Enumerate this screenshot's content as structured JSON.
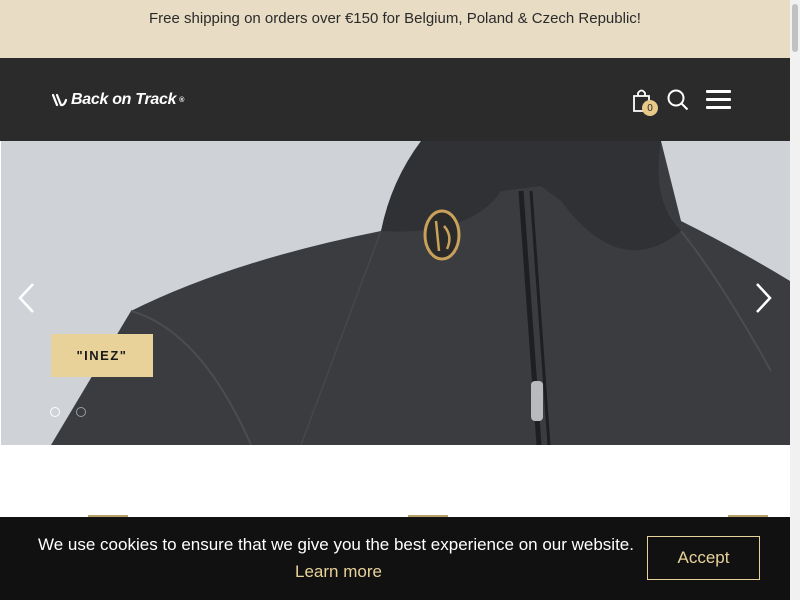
{
  "announcement": {
    "text": "Free shipping on orders over €150 for Belgium, Poland & Czech Republic!"
  },
  "header": {
    "logo_text": "Back on Track",
    "logo_reg": "®",
    "cart_count": "0",
    "icons": [
      "cart-icon",
      "search-icon",
      "menu-icon"
    ]
  },
  "hero": {
    "slide_label": "\"INEZ\"",
    "slides_total": 2,
    "active_slide": 1,
    "prev_icon": "chevron-left-icon",
    "next_icon": "chevron-right-icon"
  },
  "cookie_banner": {
    "message": "We use cookies to ensure that we give you the best experience on our website.",
    "learn_more": "Learn more",
    "accept": "Accept"
  },
  "colors": {
    "announcement_bg": "#e8dcc4",
    "header_bg": "#2b2b2b",
    "accent_gold": "#e8d29a",
    "cookie_bg": "#111111"
  }
}
